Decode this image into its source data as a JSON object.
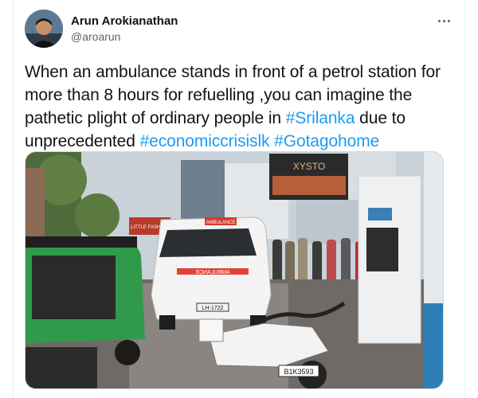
{
  "author": {
    "display_name": "Arun Arokianathan",
    "handle": "@aroarun"
  },
  "tweet": {
    "text_segments": [
      {
        "text": "When an ambulance stands in front of a petrol station for more than 8 hours for refuelling ,you can imagine the pathetic plight of ordinary people in ",
        "type": "plain"
      },
      {
        "text": "#Srilanka",
        "type": "hashtag"
      },
      {
        "text": " due to unprecedented ",
        "type": "plain"
      },
      {
        "text": "#economiccrisislk",
        "type": "hashtag"
      },
      {
        "text": " ",
        "type": "plain"
      },
      {
        "text": "#Gotagohome",
        "type": "hashtag"
      }
    ]
  },
  "media": {
    "ambulance_top_label": "AMBULANCE",
    "ambulance_front_label": "AMBULANCE",
    "ambulance_plate": "LH-1722",
    "bike_plate": "B1K3593",
    "billboard_text": "XYSTO",
    "shop_sign": "LITTLE FASHION"
  },
  "icons": {
    "more": "more-horizontal-icon"
  },
  "colors": {
    "hashtag": "#1d9bf0",
    "text": "#0f1419",
    "muted": "#536471"
  }
}
